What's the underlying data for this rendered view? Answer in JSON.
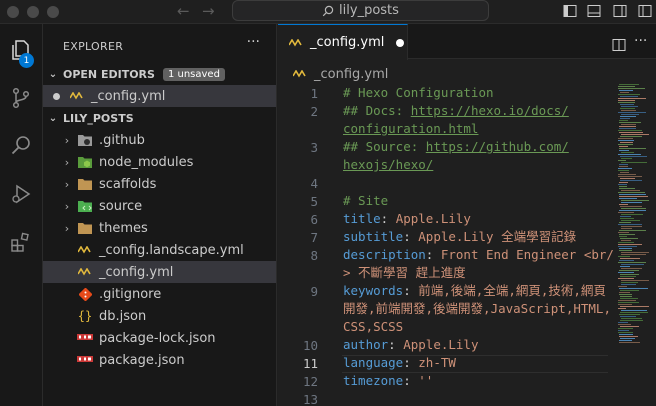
{
  "window": {
    "search_label": "lily_posts"
  },
  "activity": {
    "badge_count": "1"
  },
  "sidebar": {
    "title": "EXPLORER",
    "more": "···",
    "open_editors": {
      "label": "OPEN EDITORS",
      "badge": "1 unsaved",
      "files": [
        {
          "name": "_config.yml",
          "icon": "yaml-icon",
          "dirty": true
        }
      ]
    },
    "project": {
      "label": "LILY_POSTS",
      "items": [
        {
          "name": ".github",
          "type": "folder",
          "icon": "github-folder-icon"
        },
        {
          "name": "node_modules",
          "type": "folder",
          "icon": "node-folder-icon"
        },
        {
          "name": "scaffolds",
          "type": "folder",
          "icon": "scaffolds-folder-icon"
        },
        {
          "name": "source",
          "type": "folder",
          "icon": "source-folder-icon"
        },
        {
          "name": "themes",
          "type": "folder",
          "icon": "themes-folder-icon"
        },
        {
          "name": "_config.landscape.yml",
          "type": "file",
          "icon": "yaml-icon"
        },
        {
          "name": "_config.yml",
          "type": "file",
          "icon": "yaml-icon",
          "selected": true
        },
        {
          "name": ".gitignore",
          "type": "file",
          "icon": "git-icon"
        },
        {
          "name": "db.json",
          "type": "file",
          "icon": "json-icon"
        },
        {
          "name": "package-lock.json",
          "type": "file",
          "icon": "npm-icon"
        },
        {
          "name": "package.json",
          "type": "file",
          "icon": "npm-icon"
        }
      ]
    }
  },
  "editor": {
    "tab_label": "_config.yml",
    "breadcrumb": "_config.yml",
    "line_numbers": [
      "1",
      "2",
      "3",
      "4",
      "5",
      "6",
      "7",
      "8",
      "9",
      "10",
      "11",
      "12",
      "13"
    ],
    "active_line": "11",
    "lines": {
      "l1": "# Hexo Configuration",
      "l2a": "## Docs: ",
      "l2b": "https://hexo.io/docs/",
      "l2c": "configuration.html",
      "l3a": "## Source: ",
      "l3b": "https://github.com/",
      "l3c": "hexojs/hexo/",
      "l5": "# Site",
      "l6k": "title",
      "l6v": "Apple.Lily",
      "l7k": "subtitle",
      "l7v": "Apple.Lily 全端學習記錄",
      "l8k": "description",
      "l8v1": "Front End Engineer <br/",
      "l8v2": "> 不斷學習 趕上進度",
      "l9k": "keywords",
      "l9v1": "前端,後端,全端,網頁,技術,網頁",
      "l9v2": "開發,前端開發,後端開發,JavaScript,HTML,",
      "l9v3": "CSS,SCSS",
      "l10k": "author",
      "l10v": "Apple.Lily",
      "l11k": "language",
      "l11v": "zh-TW",
      "l12k": "timezone",
      "l12v": "''"
    }
  },
  "colors": {
    "accent": "#0078d4",
    "comment": "#6a9955",
    "key": "#569cd6",
    "value": "#ce9178"
  }
}
